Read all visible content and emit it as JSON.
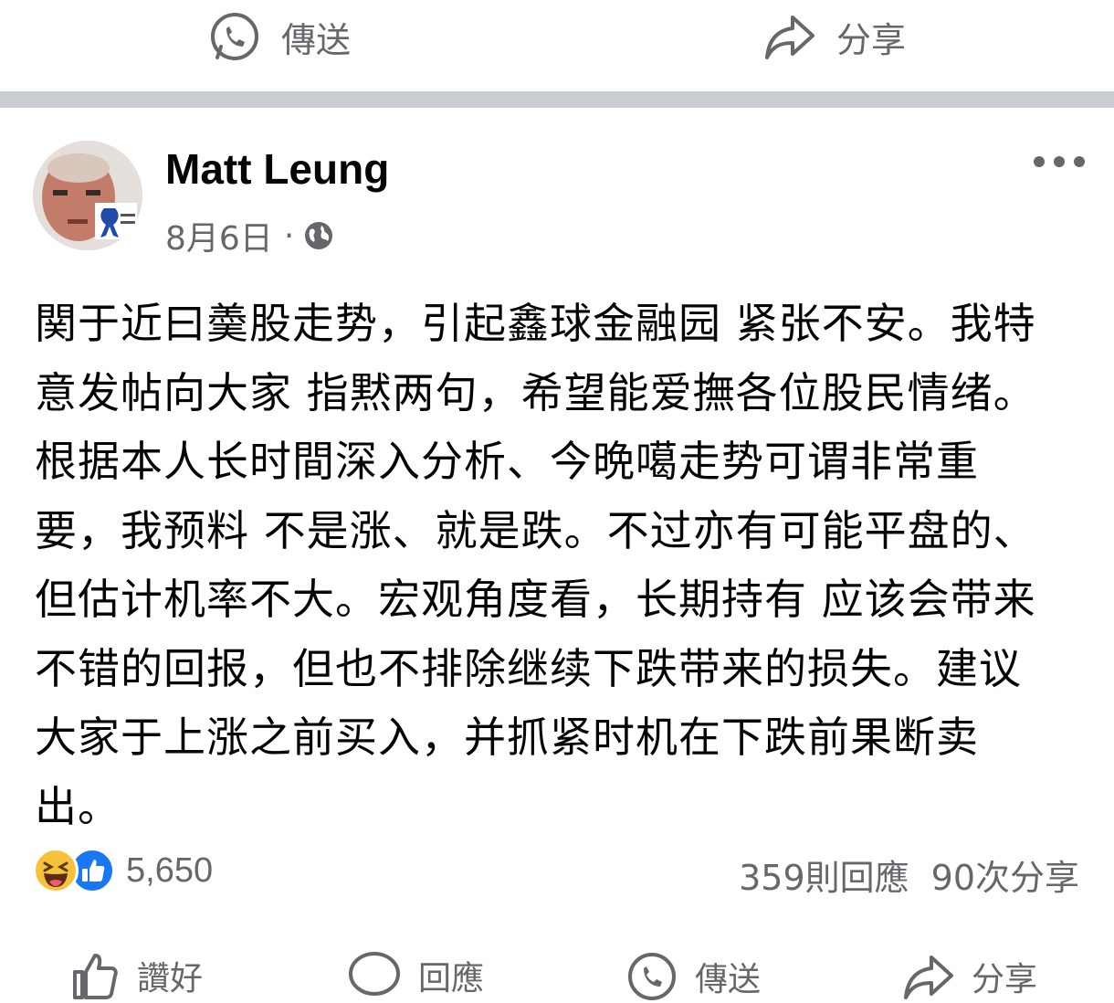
{
  "top_actions": {
    "send_label": "傳送",
    "share_label": "分享"
  },
  "post": {
    "author": "Matt Leung",
    "date": "8月6日",
    "separator": "·",
    "audience_icon": "globe-icon",
    "text_lines": [
      "関于近曰羮股走势，引起鑫球金融园 紧张不安。我特",
      "意发帖向大家 指黙两句，希望能爱撫各位股民情绪。",
      "根据本人长时間深入分析、今晩噶走势可谓非常重",
      "要，我预料 不是涨、就是跌。不过亦有可能平盘的、",
      "但估计机率不大。宏观角度看，长期持有 应该会带来",
      "不错的回报，但也不排除继续下跌带来的损失。建议",
      "大家于上涨之前买入，并抓紧时机在下跌前果断卖",
      "出。"
    ]
  },
  "engagement": {
    "reaction_count": "5,650",
    "comments": "359則回應",
    "shares": "90次分享"
  },
  "bottom_actions": {
    "like_label": "讚好",
    "comment_label": "回應",
    "send_label": "傳送",
    "share_label": "分享"
  },
  "colors": {
    "accent": "#1877f2",
    "muted": "#65676b",
    "separator": "#c9ccd1",
    "haha": "#f7c23b"
  }
}
